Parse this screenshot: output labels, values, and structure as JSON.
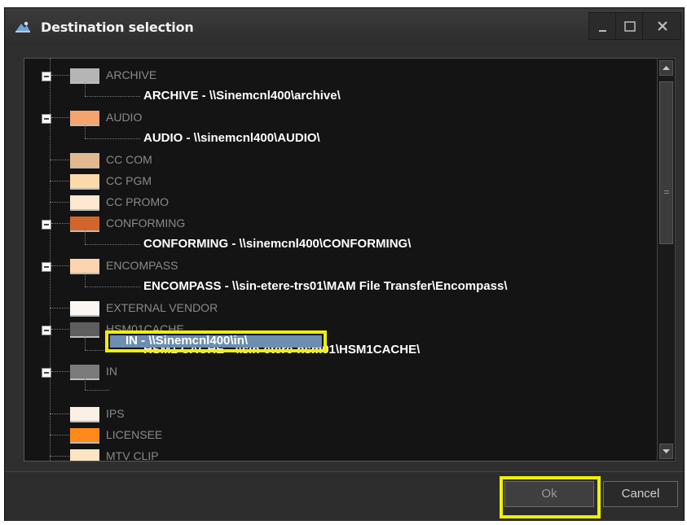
{
  "window": {
    "title": "Destination selection",
    "controls": [
      "minimize-icon",
      "maximize-icon",
      "close-icon"
    ]
  },
  "tree": {
    "items": [
      {
        "label": "ARCHIVE",
        "color": "#b5b5b5",
        "expanded": true,
        "children": [
          "ARCHIVE   -   \\\\Sinemcnl400\\archive\\"
        ]
      },
      {
        "label": "AUDIO",
        "color": "#f6a46e",
        "expanded": true,
        "children": [
          "AUDIO   -   \\\\sinemcnl400\\AUDIO\\"
        ]
      },
      {
        "label": "CC COM",
        "color": "#e2b98e",
        "expanded": false,
        "children": []
      },
      {
        "label": "CC PGM",
        "color": "#fcd9a8",
        "expanded": false,
        "children": []
      },
      {
        "label": "CC PROMO",
        "color": "#fde8d0",
        "expanded": false,
        "children": []
      },
      {
        "label": "CONFORMING",
        "color": "#d2662a",
        "expanded": true,
        "children": [
          "CONFORMING   -   \\\\sinemcnl400\\CONFORMING\\"
        ]
      },
      {
        "label": "ENCOMPASS",
        "color": "#fcd4b0",
        "expanded": true,
        "children": [
          "ENCOMPASS   -   \\\\sin-etere-trs01\\MAM File Transfer\\Encompass\\"
        ]
      },
      {
        "label": "EXTERNAL VENDOR",
        "color": "#fbf6f1",
        "expanded": false,
        "children": []
      },
      {
        "label": "HSM01CACHE",
        "color": "#5e5e5e",
        "expanded": true,
        "children": [
          "HSM1 CACHE   -   \\\\sin-etere-hsm01\\HSM1CACHE\\"
        ]
      },
      {
        "label": "IN",
        "color": "#7b7b7b",
        "expanded": true,
        "children": [
          "IN   -   \\\\Sinemcnl400\\in\\"
        ]
      },
      {
        "label": "IPS",
        "color": "#fbf0e6",
        "expanded": false,
        "children": []
      },
      {
        "label": "LICENSEE",
        "color": "#ff8a1a",
        "expanded": false,
        "children": []
      },
      {
        "label": "MTV CLIP",
        "color": "#fde4c2",
        "expanded": false,
        "children": []
      }
    ],
    "selected": "IN   -   \\\\Sinemcnl400\\in\\"
  },
  "buttons": {
    "ok": "Ok",
    "cancel": "Cancel"
  }
}
